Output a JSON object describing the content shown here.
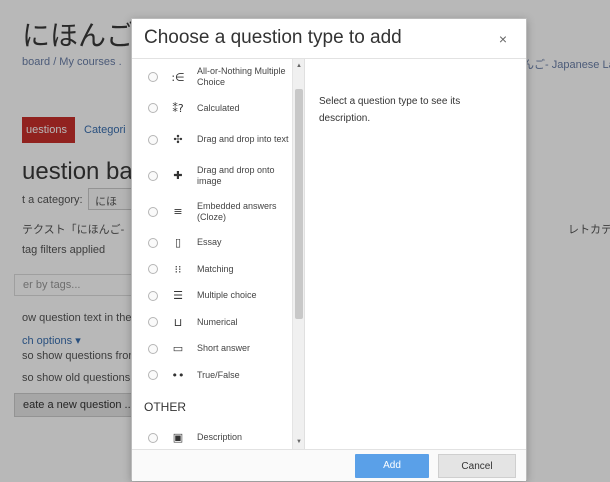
{
  "background": {
    "title": "にほんご- .",
    "breadcrumb": "board / My courses .",
    "breadcrumb_right": "んご- Japanese Lang",
    "tabs": {
      "questions": "uestions",
      "categories": "Categori"
    },
    "heading": "uestion bank",
    "category_label": "t a category:",
    "category_value": "にほ",
    "context_text": "テクスト「にほんご-",
    "right_text": "レトカテゴリです。",
    "tag_filters": "tag filters applied",
    "tag_input_placeholder": "er by tags...",
    "show_question_text": "ow question text in the",
    "search_options": "ch options ▾",
    "show_subcat": "so show questions fron",
    "show_old": "so show old questions",
    "create_button": "eate a new question ..."
  },
  "modal": {
    "title": "Choose a question type to add",
    "close_symbol": "×",
    "description": "Select a question type to see its description.",
    "questions": [
      {
        "label": "All-or-Nothing Multiple Choice",
        "icon": "all-or-nothing-icon",
        "glyph": ":∈"
      },
      {
        "label": "Calculated",
        "icon": "calculated-icon",
        "glyph": "⁑?"
      },
      {
        "label": "Drag and drop into text",
        "icon": "drag-drop-text-icon",
        "glyph": "✣"
      },
      {
        "label": "Drag and drop onto image",
        "icon": "drag-drop-image-icon",
        "glyph": "✚"
      },
      {
        "label": "Embedded answers (Cloze)",
        "icon": "cloze-icon",
        "glyph": "≡"
      },
      {
        "label": "Essay",
        "icon": "essay-icon",
        "glyph": "▯"
      },
      {
        "label": "Matching",
        "icon": "matching-icon",
        "glyph": "⁝⁝"
      },
      {
        "label": "Multiple choice",
        "icon": "multiple-choice-icon",
        "glyph": "☰"
      },
      {
        "label": "Numerical",
        "icon": "numerical-icon",
        "glyph": "⊔"
      },
      {
        "label": "Short answer",
        "icon": "short-answer-icon",
        "glyph": "▭"
      },
      {
        "label": "True/False",
        "icon": "true-false-icon",
        "glyph": "••"
      }
    ],
    "other_heading": "OTHER",
    "other": [
      {
        "label": "Description",
        "icon": "description-icon",
        "glyph": "▣"
      }
    ],
    "add_label": "Add",
    "cancel_label": "Cancel"
  },
  "colors": {
    "add_button": "#5aa0e8",
    "active_tab": "#c9302c",
    "link": "#3a6fb0"
  }
}
